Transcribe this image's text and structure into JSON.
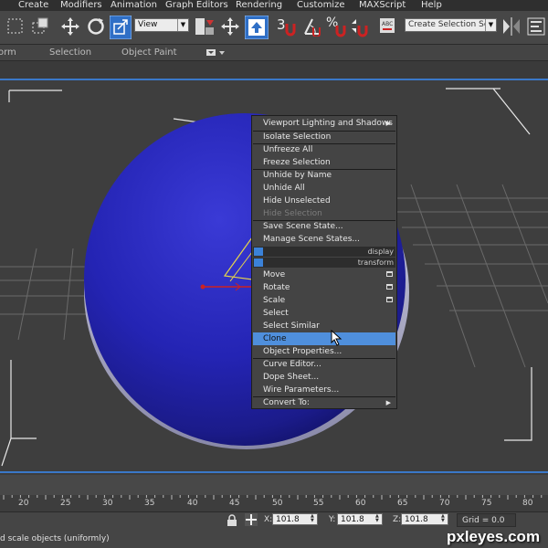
{
  "menubar": {
    "items": [
      "Create",
      "Modifiers",
      "Animation",
      "Graph Editors",
      "Rendering",
      "Customize",
      "MAXScript",
      "Help"
    ]
  },
  "toolbar": {
    "view_select": "View",
    "snap_label": "3",
    "selection_set_placeholder": "Create Selection Se"
  },
  "ribbon": {
    "items": [
      "orm",
      "Selection",
      "Object Paint"
    ]
  },
  "quad_menu": {
    "items": [
      "Viewport Lighting and Shadows",
      "Isolate Selection",
      "Unfreeze All",
      "Freeze Selection",
      "Unhide by Name",
      "Unhide All",
      "Hide Unselected",
      "Hide Selection",
      "Save Scene State...",
      "Manage Scene States...",
      "Move",
      "Rotate",
      "Scale",
      "Select",
      "Select Similar",
      "Clone",
      "Object Properties...",
      "Curve Editor...",
      "Dope Sheet...",
      "Wire Parameters...",
      "Convert To:"
    ],
    "quadrant_labels": [
      "display",
      "transform"
    ],
    "highlighted": "Clone",
    "disabled": [
      "Hide Selection"
    ]
  },
  "timeline": {
    "ticks": [
      "20",
      "25",
      "30",
      "35",
      "40",
      "45",
      "50",
      "55",
      "60",
      "65",
      "70",
      "75",
      "80"
    ]
  },
  "status": {
    "prompt": "d scale objects (uniformly)",
    "x_label": "X:",
    "x_value": "101.8",
    "y_label": "Y:",
    "y_value": "101.8",
    "z_label": "Z:",
    "z_value": "101.8",
    "grid": "Grid = 0.0"
  },
  "watermark": "pxleyes.com",
  "colors": {
    "sphere": "#2424b4",
    "highlight": "#4f8fdc",
    "viewport_border": "#3a78c8"
  },
  "icons": [
    "select-region-icon",
    "select-move-icon",
    "select-rotate-icon",
    "select-scale-icon",
    "mirror-icon",
    "align-icon",
    "manage-layers-icon",
    "snap-icon",
    "angle-snap-icon",
    "percent-snap-icon",
    "spinner-snap-icon",
    "edit-named-selection-icon",
    "mouse-cursor-icon"
  ]
}
